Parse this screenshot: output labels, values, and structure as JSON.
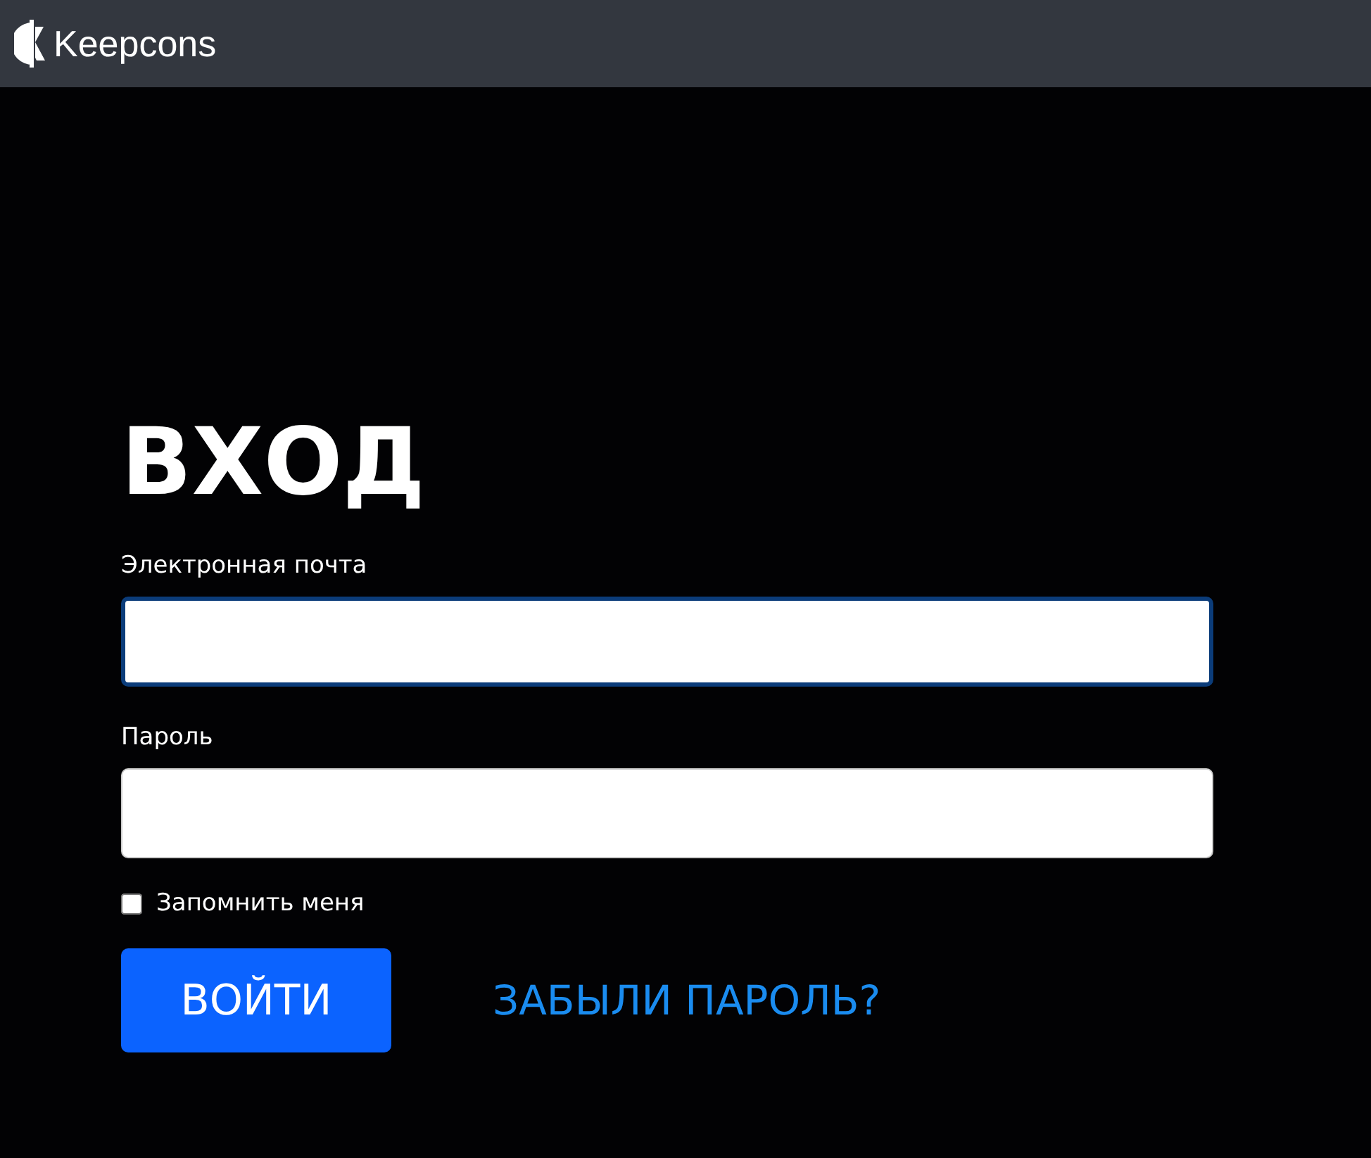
{
  "header": {
    "logo_text": "Keepcons"
  },
  "title": "ВХОД",
  "fields": [
    {
      "label": "Электронная почта",
      "focused": true
    },
    {
      "label": "Пароль",
      "focused": false
    }
  ],
  "remember": {
    "label": "Запомнить меня",
    "checked": false
  },
  "submit_button": "ВОЙТИ",
  "forgot_link": "ЗАБЫЛИ ПАРОЛЬ?"
}
